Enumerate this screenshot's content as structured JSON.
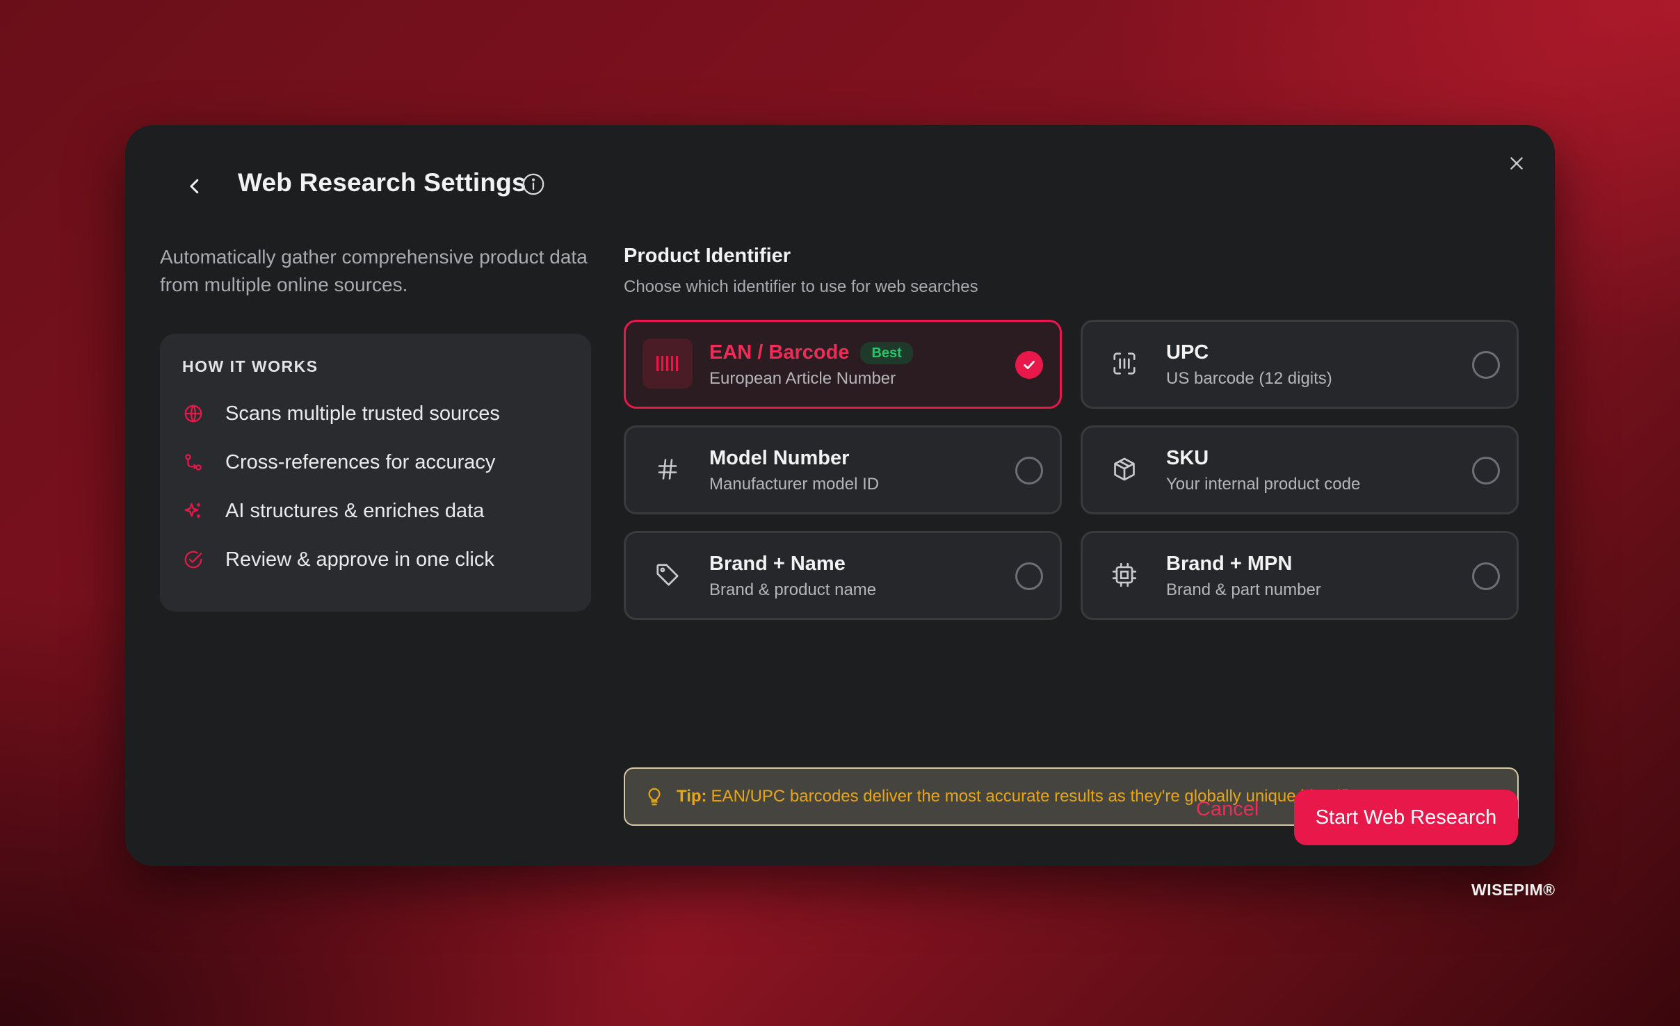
{
  "modal": {
    "title": "Web Research Settings",
    "description": "Automatically gather comprehensive product data from multiple online sources."
  },
  "how_it_works": {
    "title": "HOW IT WORKS",
    "items": [
      {
        "label": "Scans multiple trusted sources",
        "icon": "globe-icon"
      },
      {
        "label": "Cross-references for accuracy",
        "icon": "git-compare-icon"
      },
      {
        "label": "AI structures & enriches data",
        "icon": "sparkles-icon"
      },
      {
        "label": "Review & approve in one click",
        "icon": "check-circle-icon"
      }
    ]
  },
  "identifier": {
    "title": "Product Identifier",
    "subtitle": "Choose which identifier to use for web searches",
    "options": [
      {
        "label": "EAN / Barcode",
        "sub": "European Article Number",
        "badge": "Best",
        "selected": true,
        "icon": "barcode-icon"
      },
      {
        "label": "UPC",
        "sub": "US barcode (12 digits)",
        "selected": false,
        "icon": "scan-barcode-icon"
      },
      {
        "label": "Model Number",
        "sub": "Manufacturer model ID",
        "selected": false,
        "icon": "hash-icon"
      },
      {
        "label": "SKU",
        "sub": "Your internal product code",
        "selected": false,
        "icon": "package-icon"
      },
      {
        "label": "Brand + Name",
        "sub": "Brand & product name",
        "selected": false,
        "icon": "tag-icon"
      },
      {
        "label": "Brand + MPN",
        "sub": "Brand & part number",
        "selected": false,
        "icon": "cpu-icon"
      }
    ]
  },
  "tip": {
    "label": "Tip:",
    "text": "EAN/UPC barcodes deliver the most accurate results as they're globally unique identifiers."
  },
  "actions": {
    "cancel": "Cancel",
    "start": "Start Web Research"
  },
  "brand": "WISEPIM®",
  "colors": {
    "accent": "#e8184a",
    "tip_text": "#e8a617",
    "badge_green": "#28c46a",
    "modal_bg": "#1d1e20"
  }
}
